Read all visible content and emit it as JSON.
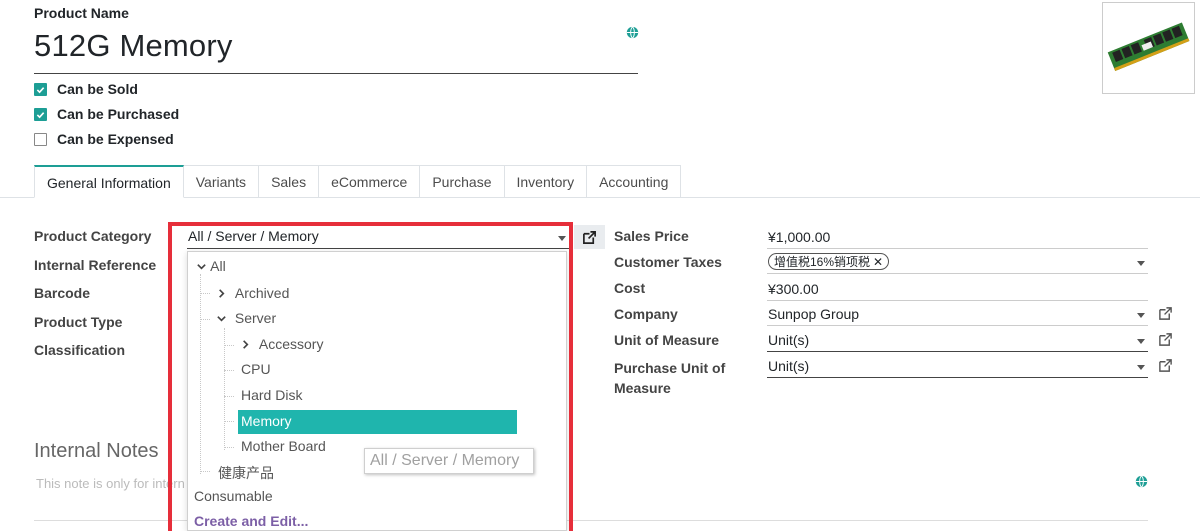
{
  "product": {
    "name_label": "Product Name",
    "name": "512G Memory",
    "checkboxes": [
      {
        "label": "Can be Sold",
        "checked": true
      },
      {
        "label": "Can be Purchased",
        "checked": true
      },
      {
        "label": "Can be Expensed",
        "checked": false
      }
    ]
  },
  "tabs": [
    "General Information",
    "Variants",
    "Sales",
    "eCommerce",
    "Purchase",
    "Inventory",
    "Accounting"
  ],
  "active_tab": "General Information",
  "left_fields": {
    "category_label": "Product Category",
    "category_value": "All / Server / Memory",
    "internal_ref_label": "Internal Reference",
    "barcode_label": "Barcode",
    "product_type_label": "Product Type",
    "classification_label": "Classification"
  },
  "dropdown": {
    "items": [
      {
        "label": "All",
        "expander": "chevron-down"
      },
      {
        "label": "Archived",
        "expander": "chevron-right"
      },
      {
        "label": "Server",
        "expander": "chevron-down"
      },
      {
        "label": "Accessory",
        "expander": "chevron-right"
      },
      {
        "label": "CPU"
      },
      {
        "label": "Hard Disk"
      },
      {
        "label": "Memory",
        "selected": true
      },
      {
        "label": "Mother Board"
      },
      {
        "label": "健康产品"
      },
      {
        "label": "Consumable"
      }
    ],
    "create_edit": "Create and Edit...",
    "tooltip": "All / Server / Memory"
  },
  "notes": {
    "heading": "Internal Notes",
    "placeholder": "This note is only for intern"
  },
  "right_fields": {
    "sales_price_label": "Sales Price",
    "sales_price": "¥1,000.00",
    "customer_taxes_label": "Customer Taxes",
    "tax_tag": "增值税16%销项税",
    "cost_label": "Cost",
    "cost": "¥300.00",
    "company_label": "Company",
    "company": "Sunpop Group",
    "uom_label": "Unit of Measure",
    "uom": "Unit(s)",
    "purchase_uom_label_1": "Purchase Unit of",
    "purchase_uom_label_2": "Measure",
    "purchase_uom": "Unit(s)"
  },
  "colors": {
    "accent": "#1d9e95",
    "highlight": "#1fb5ad",
    "annotation_red": "#e62e3a",
    "link": "#7c5fa6"
  }
}
